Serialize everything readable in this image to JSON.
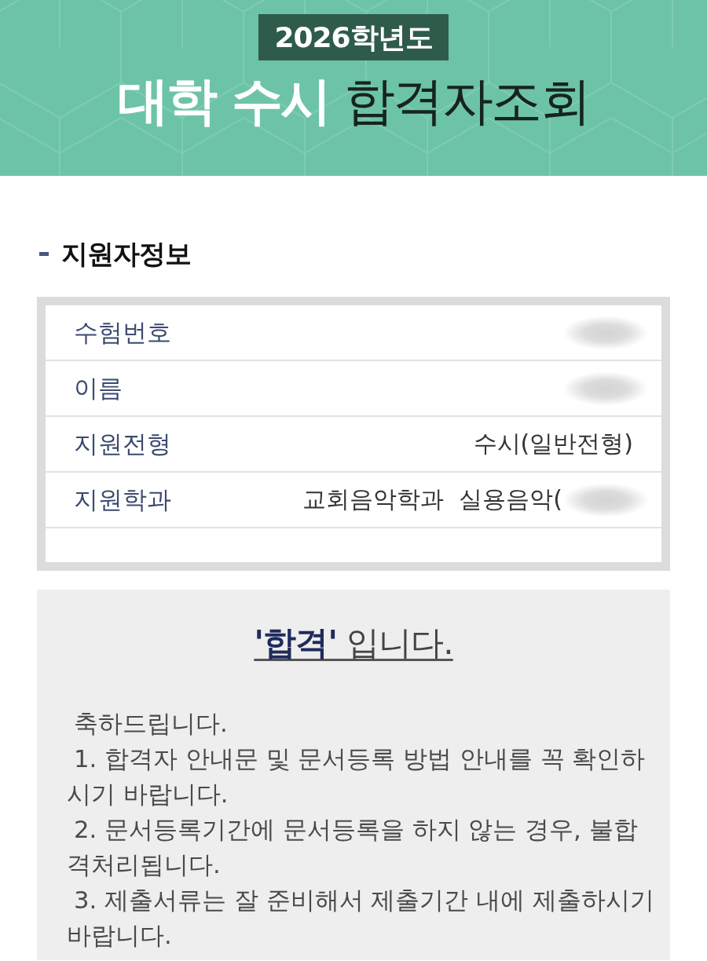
{
  "header": {
    "year_badge": "2026학년도",
    "title": "**대학 수시** 합격자조회"
  },
  "applicant_info": {
    "heading": "지원자정보",
    "rows": [
      {
        "label": "수험번호",
        "redacted": true
      },
      {
        "label": "이름",
        "redacted": true
      },
      {
        "label": "지원전형",
        "value": "수시(일반전형)",
        "redacted": false
      },
      {
        "label": "지원학과",
        "value": "교회음악학과  실용음악(",
        "redacted": true
      }
    ]
  },
  "result": {
    "headline": "**'합격'** 입니다.",
    "notice": [
      "축하드립니다.",
      "1. 합격자 안내문 및 문서등록 방법 안내를 꼭 확인하시기 바랍니다.",
      "2. 문서등록기간에 문서등록을 하지 않는 경우, 불합격처리됩니다.",
      "3. 제출서류는 잘 준비해서 제출기간 내에 제출하시기 바랍니다."
    ]
  }
}
